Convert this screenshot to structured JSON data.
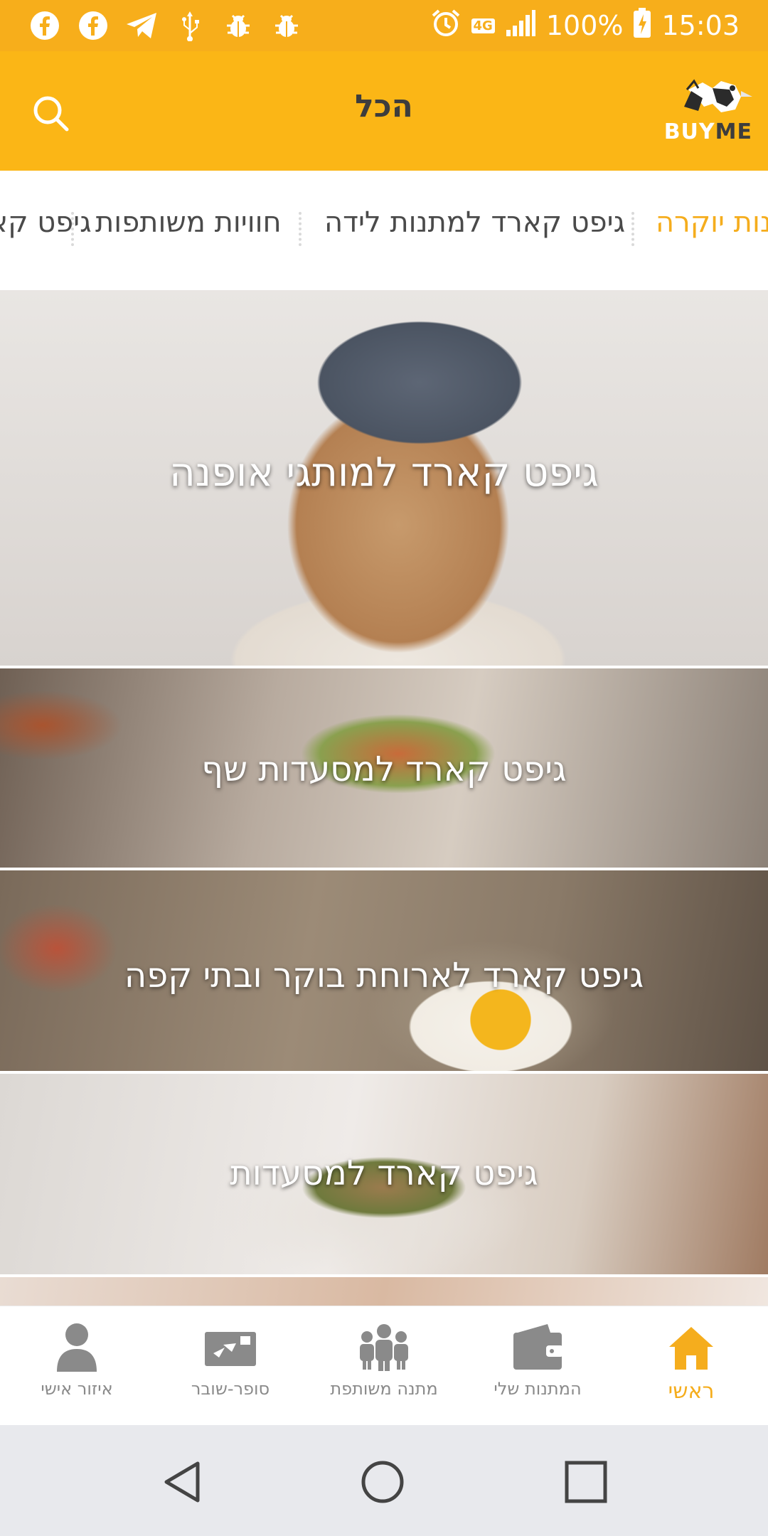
{
  "status_bar": {
    "battery": "100%",
    "time": "15:03",
    "network": "4G",
    "icons": [
      "facebook-icon",
      "facebook-icon",
      "telegram-icon",
      "usb-icon",
      "bug-icon",
      "bug-icon",
      "alarm-icon",
      "signal-icon",
      "battery-icon"
    ]
  },
  "app_bar": {
    "title": "הכל",
    "logo_text_buy": "BUY",
    "logo_text_me": "ME"
  },
  "categories": [
    {
      "label": "מתנות יוקרה",
      "active": true
    },
    {
      "label": "גיפט קארד למתנות לידה",
      "active": false
    },
    {
      "label": "חוויות משותפות",
      "active": false
    },
    {
      "label": "גיפט קארד",
      "active": false
    }
  ],
  "banners": [
    {
      "label": "גיפט קארד למותגי אופנה"
    },
    {
      "label": "גיפט קארד למסעדות שף"
    },
    {
      "label": "גיפט קארד לארוחת בוקר ובתי קפה"
    },
    {
      "label": "גיפט קארד למסעדות"
    }
  ],
  "bottom_nav": [
    {
      "label": "ראשי",
      "icon": "home-icon",
      "active": true
    },
    {
      "label": "המתנות שלי",
      "icon": "wallet-icon",
      "active": false
    },
    {
      "label": "מתנה משותפת",
      "icon": "group-icon",
      "active": false
    },
    {
      "label": "סופר-שובר",
      "icon": "gift-card-icon",
      "active": false
    },
    {
      "label": "איזור אישי",
      "icon": "person-icon",
      "active": false
    }
  ],
  "colors": {
    "brand": "#fbb616",
    "status_bar": "#f7ae1b",
    "active": "#f5ad1d",
    "inactive": "#8a8a8a"
  }
}
